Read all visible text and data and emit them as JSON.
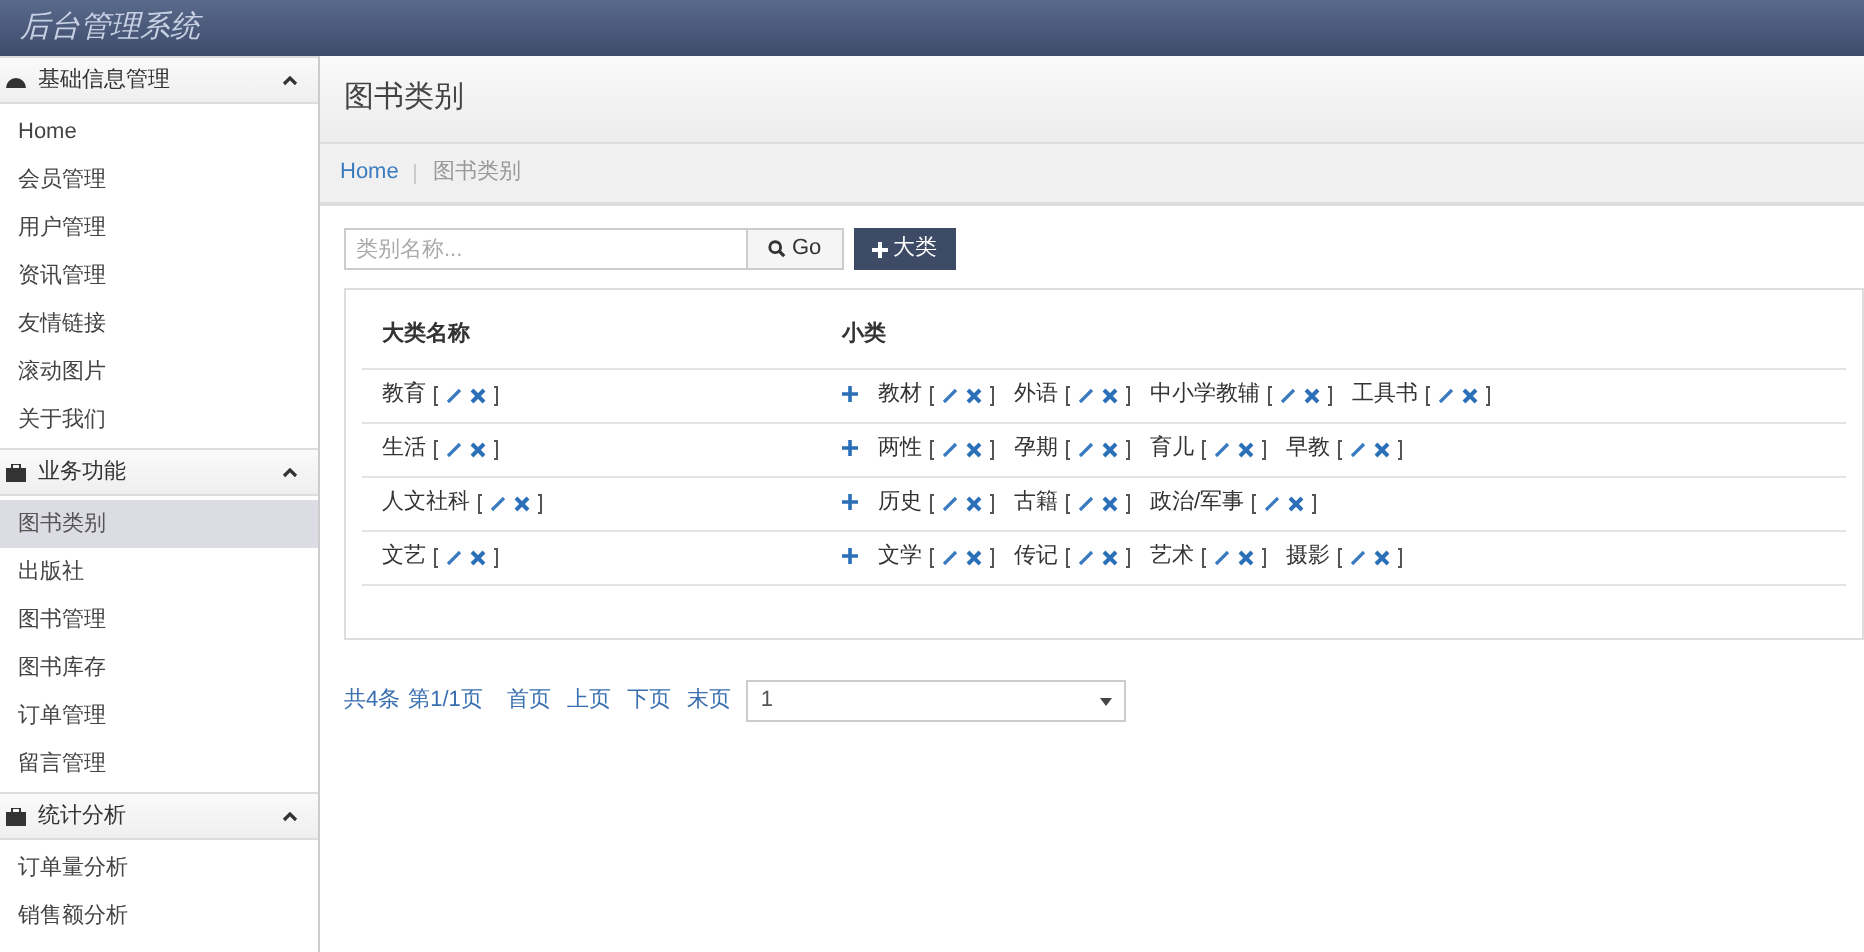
{
  "app_title": "后台管理系统",
  "sidebar": [
    {
      "title": "基础信息管理",
      "expanded": true,
      "items": [
        {
          "label": "Home",
          "selected": false
        },
        {
          "label": "会员管理",
          "selected": false
        },
        {
          "label": "用户管理",
          "selected": false
        },
        {
          "label": "资讯管理",
          "selected": false
        },
        {
          "label": "友情链接",
          "selected": false
        },
        {
          "label": "滚动图片",
          "selected": false
        },
        {
          "label": "关于我们",
          "selected": false
        }
      ]
    },
    {
      "title": "业务功能",
      "expanded": true,
      "items": [
        {
          "label": "图书类别",
          "selected": true
        },
        {
          "label": "出版社",
          "selected": false
        },
        {
          "label": "图书管理",
          "selected": false
        },
        {
          "label": "图书库存",
          "selected": false
        },
        {
          "label": "订单管理",
          "selected": false
        },
        {
          "label": "留言管理",
          "selected": false
        }
      ]
    },
    {
      "title": "统计分析",
      "expanded": true,
      "items": [
        {
          "label": "订单量分析",
          "selected": false
        },
        {
          "label": "销售额分析",
          "selected": false
        }
      ]
    }
  ],
  "page_title": "图书类别",
  "breadcrumb": [
    "Home",
    "图书类别"
  ],
  "search": {
    "placeholder": "类别名称...",
    "button": "Go"
  },
  "add_button": "大类",
  "table": {
    "columns": [
      "大类名称",
      "小类"
    ],
    "rows": [
      {
        "name": "教育",
        "subs": [
          "教材",
          "外语",
          "中小学教辅",
          "工具书"
        ]
      },
      {
        "name": "生活",
        "subs": [
          "两性",
          "孕期",
          "育儿",
          "早教"
        ]
      },
      {
        "name": "人文社科",
        "subs": [
          "历史",
          "古籍",
          "政治/军事"
        ]
      },
      {
        "name": "文艺",
        "subs": [
          "文学",
          "传记",
          "艺术",
          "摄影"
        ]
      }
    ]
  },
  "pagination": {
    "summary": [
      "共4条",
      "第1/1页"
    ],
    "links": [
      "首页",
      "上页",
      "下页",
      "末页"
    ],
    "page_select": "1"
  }
}
